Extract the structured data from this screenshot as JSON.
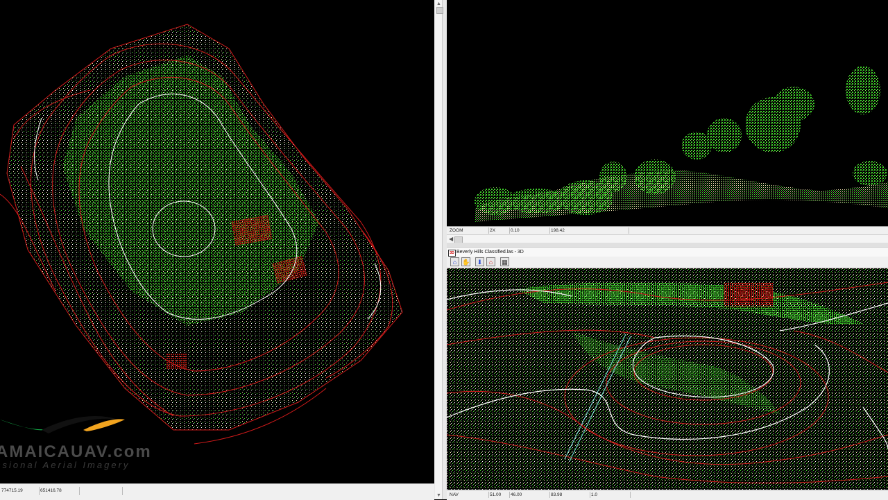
{
  "left_view": {
    "status": {
      "x_coord": "774715.19",
      "y_coord": "651416.78"
    },
    "watermark": {
      "name": "AMAICAUAV.com",
      "tagline": "ssional Aerial Imagery"
    }
  },
  "top_right_view": {
    "status": {
      "mode": "ZOOM",
      "zoom": "2X",
      "value1": "0.10",
      "value2": "198.42"
    }
  },
  "window_3d": {
    "title": "Beverly Hills Classified.las - 3D",
    "title_icon": "3D",
    "toolbar": [
      {
        "name": "home-icon",
        "glyph": "⌂"
      },
      {
        "name": "hand-icon",
        "glyph": "✋"
      },
      {
        "name": "arrow-down-icon",
        "glyph": "⬇"
      },
      {
        "name": "home-red-icon",
        "glyph": "⌂"
      },
      {
        "name": "grid-icon",
        "glyph": "▦"
      }
    ],
    "status": {
      "mode": "NAV",
      "v1": "51.00",
      "v2": "46.00",
      "v3": "83.98",
      "v4": "1.0"
    }
  },
  "colors": {
    "contour_red": "#d11a1a",
    "contour_white": "#ffffff",
    "vegetation_green": "#3fd42a",
    "ground_cream": "#f2e6b3",
    "building_red": "#c0160f",
    "profile_cyan": "#7fe3e0"
  }
}
